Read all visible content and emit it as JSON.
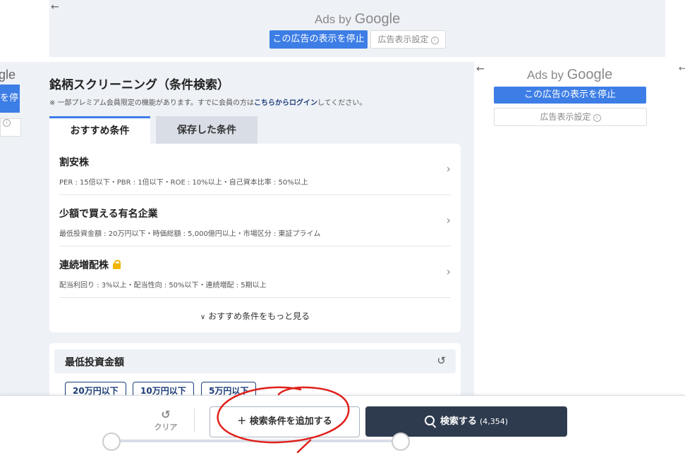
{
  "top_ad": {
    "back": "←",
    "ads_by": "Ads by",
    "google": "Google",
    "stop_label": "この広告の表示を停止",
    "settings_label": "広告表示設定",
    "info": "i"
  },
  "left_ad": {
    "google_fragment": "gle",
    "stop_fragment": "を停",
    "info": "i"
  },
  "right_ad": {
    "back": "←",
    "ads_by": "Ads by",
    "google": "Google",
    "stop_label": "この広告の表示を停止",
    "settings_label": "広告表示設定",
    "info": "i",
    "far_arrow": "←"
  },
  "page": {
    "title": "銘柄スクリーニング（条件検索）",
    "note_prefix": "※ 一部プレミアム会員限定の機能があります。すでに会員の方は",
    "note_link": "こちらからログイン",
    "note_suffix": "してください。"
  },
  "tabs": [
    {
      "label": "おすすめ条件",
      "active": true
    },
    {
      "label": "保存した条件",
      "active": false
    }
  ],
  "recommended": [
    {
      "title": "割安株",
      "desc": "PER : 15倍以下・PBR : 1倍以下・ROE : 10%以上・自己資本比率 : 50%以上",
      "locked": false
    },
    {
      "title": "少額で買える有名企業",
      "desc": "最低投資金額 : 20万円以下・時価総額 : 5,000億円以上・市場区分 : 東証プライム",
      "locked": false
    },
    {
      "title": "連続増配株",
      "desc": "配当利回り : 3%以上・配当性向 : 50%以下・連続増配 : 5期以上",
      "locked": true
    }
  ],
  "more_label": "おすすめ条件をもっと見る",
  "chevron": "›",
  "chevron_down": "∨",
  "min_invest": {
    "title": "最低投資金額",
    "reset_icon": "↺",
    "chips": [
      "20万円以下",
      "10万円以下",
      "5万円以下"
    ]
  },
  "bottom": {
    "clear_icon": "↺",
    "clear_label": "クリア",
    "add_label": "＋ 検索条件を追加する",
    "search_label": "検索する",
    "search_count": "(4,354)"
  },
  "colors": {
    "accent": "#3d7de6",
    "navy": "#1b3d7a",
    "search_button": "#2e3b4e",
    "annotation": "#e0201a"
  }
}
